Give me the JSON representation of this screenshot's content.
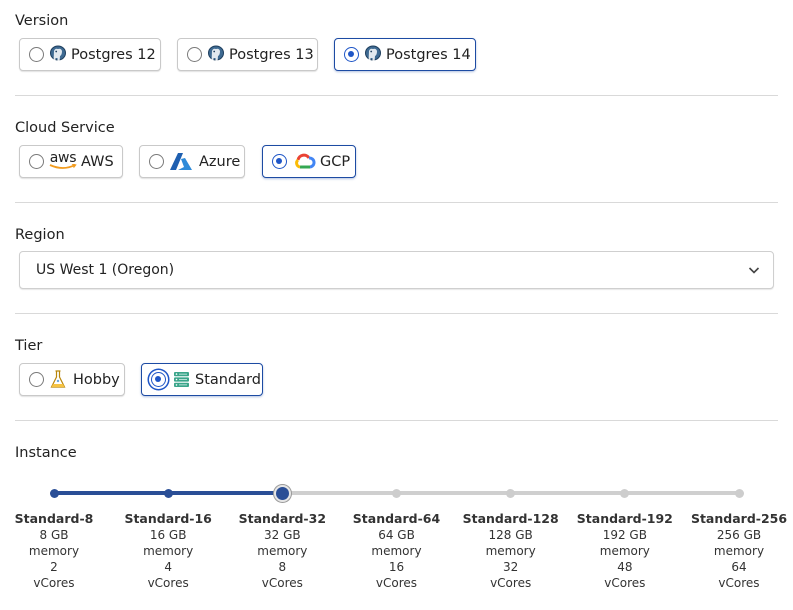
{
  "version": {
    "label": "Version",
    "options": [
      {
        "label": "Postgres 12",
        "selected": false
      },
      {
        "label": "Postgres 13",
        "selected": false
      },
      {
        "label": "Postgres 14",
        "selected": true
      }
    ]
  },
  "cloud": {
    "label": "Cloud Service",
    "options": [
      {
        "label": "AWS",
        "logo_text": "aws",
        "selected": false
      },
      {
        "label": "Azure",
        "selected": false
      },
      {
        "label": "GCP",
        "selected": true
      }
    ]
  },
  "region": {
    "label": "Region",
    "value": "US West 1 (Oregon)"
  },
  "tier": {
    "label": "Tier",
    "options": [
      {
        "label": "Hobby",
        "selected": false
      },
      {
        "label": "Standard",
        "selected": true
      }
    ]
  },
  "instance": {
    "label": "Instance",
    "selected_index": 2,
    "steps": [
      {
        "name": "Standard-8",
        "memory": "8 GB",
        "memory_label": "memory",
        "vcores": "2",
        "vcores_label": "vCores"
      },
      {
        "name": "Standard-16",
        "memory": "16 GB",
        "memory_label": "memory",
        "vcores": "4",
        "vcores_label": "vCores"
      },
      {
        "name": "Standard-32",
        "memory": "32 GB",
        "memory_label": "memory",
        "vcores": "8",
        "vcores_label": "vCores"
      },
      {
        "name": "Standard-64",
        "memory": "64 GB",
        "memory_label": "memory",
        "vcores": "16",
        "vcores_label": "vCores"
      },
      {
        "name": "Standard-128",
        "memory": "128 GB",
        "memory_label": "memory",
        "vcores": "32",
        "vcores_label": "vCores"
      },
      {
        "name": "Standard-192",
        "memory": "192 GB",
        "memory_label": "memory",
        "vcores": "48",
        "vcores_label": "vCores"
      },
      {
        "name": "Standard-256",
        "memory": "256 GB",
        "memory_label": "memory",
        "vcores": "64",
        "vcores_label": "vCores"
      }
    ]
  },
  "colors": {
    "accent": "#1f56c7",
    "slider_fill": "#2a4e96",
    "slider_track": "#cfcfcf"
  },
  "icons": {
    "postgres": "postgres-elephant-icon",
    "aws": "aws-logo-icon",
    "azure": "azure-logo-icon",
    "gcp": "google-cloud-logo-icon",
    "hobby": "flask-icon",
    "standard": "server-stack-icon",
    "select_chevron": "chevron-down-icon"
  }
}
